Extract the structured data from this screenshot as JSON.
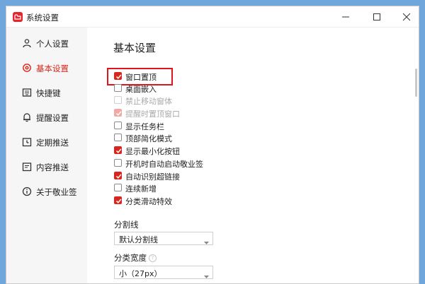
{
  "window": {
    "title": "系统设置"
  },
  "sidebar": {
    "items": [
      {
        "label": "个人设置",
        "icon": "user-icon"
      },
      {
        "label": "基本设置",
        "icon": "settings-icon",
        "active": true
      },
      {
        "label": "快捷键",
        "icon": "keyboard-icon"
      },
      {
        "label": "提醒设置",
        "icon": "bell-icon"
      },
      {
        "label": "定期推送",
        "icon": "calendar-icon"
      },
      {
        "label": "内容推送",
        "icon": "document-icon"
      },
      {
        "label": "关于敬业签",
        "icon": "info-icon"
      }
    ]
  },
  "main": {
    "title": "基本设置",
    "options": [
      {
        "label": "窗口置顶",
        "checked": true,
        "disabled": false
      },
      {
        "label": "桌面嵌入",
        "checked": false,
        "disabled": false
      },
      {
        "label": "禁止移动窗体",
        "checked": false,
        "disabled": true
      },
      {
        "label": "提醒时置顶窗口",
        "checked": true,
        "disabled": true
      },
      {
        "label": "显示任务栏",
        "checked": false,
        "disabled": false
      },
      {
        "label": "顶部简化模式",
        "checked": false,
        "disabled": false
      },
      {
        "label": "显示最小化按钮",
        "checked": true,
        "disabled": false
      },
      {
        "label": "开机时自动启动敬业签",
        "checked": false,
        "disabled": false
      },
      {
        "label": "自动识别超链接",
        "checked": true,
        "disabled": false
      },
      {
        "label": "连续新增",
        "checked": false,
        "disabled": false
      },
      {
        "label": "分类滑动特效",
        "checked": true,
        "disabled": false
      }
    ],
    "divider": {
      "label": "分割线",
      "value": "默认分割线"
    },
    "category_width": {
      "label": "分类宽度",
      "value": "小（27px）"
    }
  },
  "colors": {
    "accent": "#d9251d",
    "highlight": "#e0141d"
  }
}
